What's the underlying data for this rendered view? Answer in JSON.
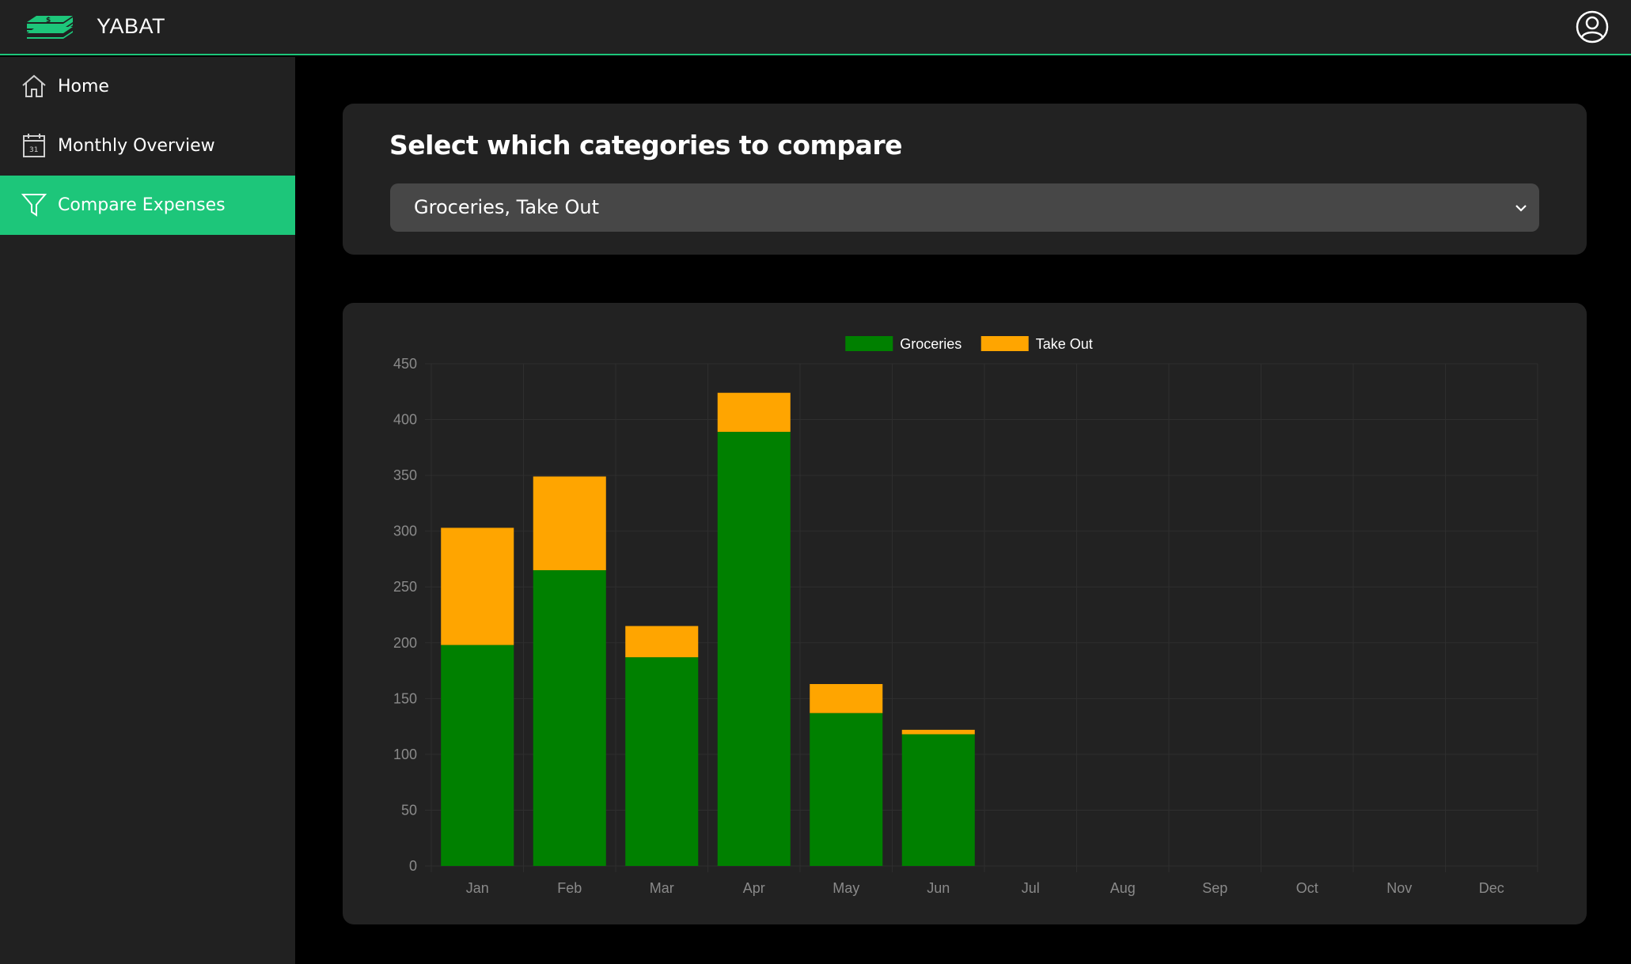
{
  "app": {
    "title": "YABAT",
    "logo_icon": "money-stack-icon",
    "user_icon": "user-circle-icon"
  },
  "sidebar": {
    "items": [
      {
        "label": "Home",
        "icon": "home-icon",
        "active": false
      },
      {
        "label": "Monthly Overview",
        "icon": "calendar-icon",
        "active": false
      },
      {
        "label": "Compare Expenses",
        "icon": "filter-icon",
        "active": true
      }
    ]
  },
  "category_selector": {
    "title": "Select which categories to compare",
    "selected_value": "Groceries, Take Out"
  },
  "colors": {
    "accent": "#1dc67a",
    "groceries": "#008000",
    "take_out": "#ffa500"
  },
  "chart_data": {
    "type": "bar",
    "stacked": true,
    "categories": [
      "Jan",
      "Feb",
      "Mar",
      "Apr",
      "May",
      "Jun",
      "Jul",
      "Aug",
      "Sep",
      "Oct",
      "Nov",
      "Dec"
    ],
    "series": [
      {
        "name": "Groceries",
        "color": "#008000",
        "values": [
          198,
          265,
          187,
          389,
          137,
          118,
          0,
          0,
          0,
          0,
          0,
          0
        ]
      },
      {
        "name": "Take Out",
        "color": "#ffa500",
        "values": [
          105,
          84,
          28,
          35,
          26,
          4,
          0,
          0,
          0,
          0,
          0,
          0
        ]
      }
    ],
    "ylim": [
      0,
      450
    ],
    "yticks": [
      0,
      50,
      100,
      150,
      200,
      250,
      300,
      350,
      400,
      450
    ],
    "legend_position": "top-center",
    "grid": true
  }
}
